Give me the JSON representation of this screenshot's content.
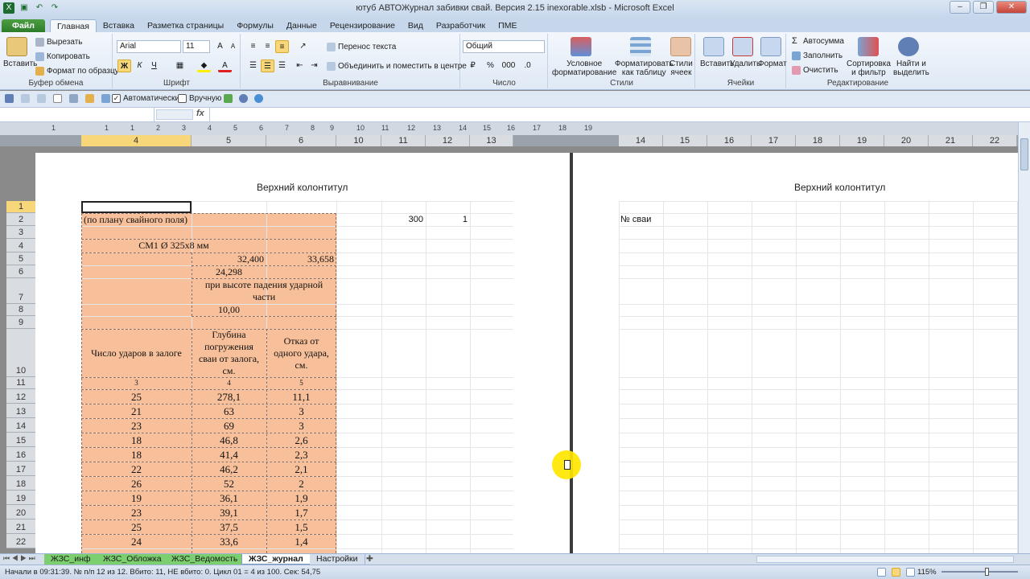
{
  "window": {
    "title": "ютуб АВТОЖурнал забивки свай. Версия 2.15 inexorable.xlsb - Microsoft Excel",
    "buttons": {
      "minimize": "–",
      "maximize": "❐",
      "close": "✕"
    }
  },
  "ribbon_tabs": [
    "Файл",
    "Главная",
    "Вставка",
    "Разметка страницы",
    "Формулы",
    "Данные",
    "Рецензирование",
    "Вид",
    "Разработчик",
    "ПМЕ"
  ],
  "ribbon": {
    "clipboard": {
      "paste": "Вставить",
      "cut": "Вырезать",
      "copy": "Копировать",
      "format_painter": "Формат по образцу",
      "label": "Буфер обмена"
    },
    "font": {
      "name": "Arial",
      "size": "11",
      "bold": "Ж",
      "italic": "К",
      "underline": "Ч",
      "label": "Шрифт"
    },
    "alignment": {
      "wrap": "Перенос текста",
      "merge": "Объединить и поместить в центре",
      "label": "Выравнивание"
    },
    "number": {
      "format": "Общий",
      "percent": "%",
      "thousands": "000",
      "label": "Число"
    },
    "styles": {
      "conditional": "Условное\nформатирование",
      "format_table": "Форматировать\nкак таблицу",
      "cell_styles": "Стили\nячеек",
      "label": "Стили"
    },
    "cells": {
      "insert": "Вставить",
      "delete": "Удалить",
      "format": "Формат",
      "label": "Ячейки"
    },
    "editing": {
      "autosum": "Автосумма",
      "fill": "Заполнить",
      "clear": "Очистить",
      "sort": "Сортировка\nи фильтр",
      "find": "Найти и\nвыделить",
      "label": "Редактирование"
    }
  },
  "qat2": {
    "auto": "Автоматически",
    "manual": "Вручную"
  },
  "formula": {
    "fx": "fx",
    "name_box": "",
    "value": ""
  },
  "column_headers_left": [
    "4",
    "5",
    "6",
    "10",
    "11",
    "12",
    "13"
  ],
  "column_headers_right": [
    "14",
    "15",
    "16",
    "17",
    "18",
    "19",
    "20",
    "21",
    "22"
  ],
  "ruler_ticks": [
    "1",
    "1",
    "1",
    "2",
    "3",
    "4",
    "5",
    "6",
    "7",
    "8",
    "9",
    "10",
    "11",
    "12",
    "13",
    "14",
    "15",
    "16",
    "17",
    "18",
    "19"
  ],
  "row_headers": [
    "1",
    "2",
    "3",
    "4",
    "5",
    "6",
    "7",
    "8",
    "9",
    "10",
    "11",
    "12",
    "13",
    "14",
    "15",
    "16",
    "17",
    "18",
    "19",
    "20",
    "21",
    "22"
  ],
  "page1": {
    "header": "Верхний колонтитул",
    "r2_text": "(по плану свайного поля)",
    "r2_val1": "300",
    "r2_val2": "1",
    "r4_text": "СМ1 Ø 325х8 мм",
    "r5_a": "32,400",
    "r5_b": "33,658",
    "r6": "24,298",
    "r7": "при высоте падения ударной части",
    "r8": "10,00",
    "h_blows": "Число ударов в залоге",
    "h_depth": "Глубина погружения сваи от залога, см.",
    "h_refusal": "Отказ от одного удара, см.",
    "colnums": [
      "3",
      "4",
      "5"
    ],
    "rows": [
      [
        "25",
        "278,1",
        "11,1"
      ],
      [
        "21",
        "63",
        "3"
      ],
      [
        "23",
        "69",
        "3"
      ],
      [
        "18",
        "46,8",
        "2,6"
      ],
      [
        "18",
        "41,4",
        "2,3"
      ],
      [
        "22",
        "46,2",
        "2,1"
      ],
      [
        "26",
        "52",
        "2"
      ],
      [
        "19",
        "36,1",
        "1,9"
      ],
      [
        "23",
        "39,1",
        "1,7"
      ],
      [
        "25",
        "37,5",
        "1,5"
      ],
      [
        "24",
        "33,6",
        "1,4"
      ]
    ]
  },
  "page2": {
    "header": "Верхний колонтитул",
    "pile_no": "№ сваи"
  },
  "sheet_tabs": [
    "ЖЗС_инф",
    "ЖЗС_Обложка",
    "ЖЗС_Ведомость",
    "ЖЗС_журнал",
    "Настройки"
  ],
  "active_sheet": "ЖЗС_журнал",
  "status": {
    "text": "Начали в 09:31:39. № п/п 12 из 12. Вбито: 11, НЕ вбито: 0. Цикл 01 = 4 из 100. Сек: 54,75",
    "zoom": "115%"
  },
  "colors": {
    "green": "#2b7a28",
    "orange": "#f8c09a",
    "selection": "#f7d779"
  }
}
